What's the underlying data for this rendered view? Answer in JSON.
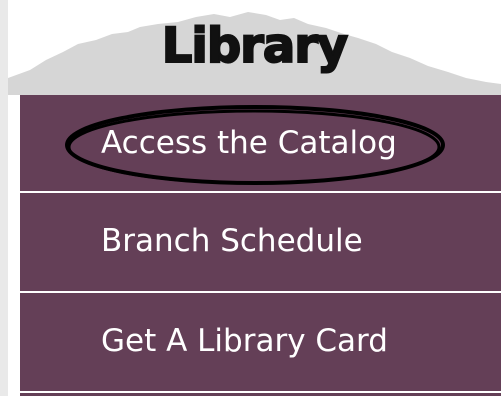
{
  "header": {
    "title": "Library"
  },
  "menu": {
    "items": [
      {
        "label": "Access the Catalog"
      },
      {
        "label": "Branch Schedule"
      },
      {
        "label": "Get A Library Card"
      }
    ]
  },
  "colors": {
    "menu_background": "#643f57",
    "menu_text": "#ffffff",
    "title_text": "#111111",
    "mountain_silhouette": "#d6d6d6",
    "annotation_ellipse": "#000000"
  },
  "icons": [
    "mountain-silhouette-icon",
    "hand-drawn-ellipse-annotation"
  ]
}
